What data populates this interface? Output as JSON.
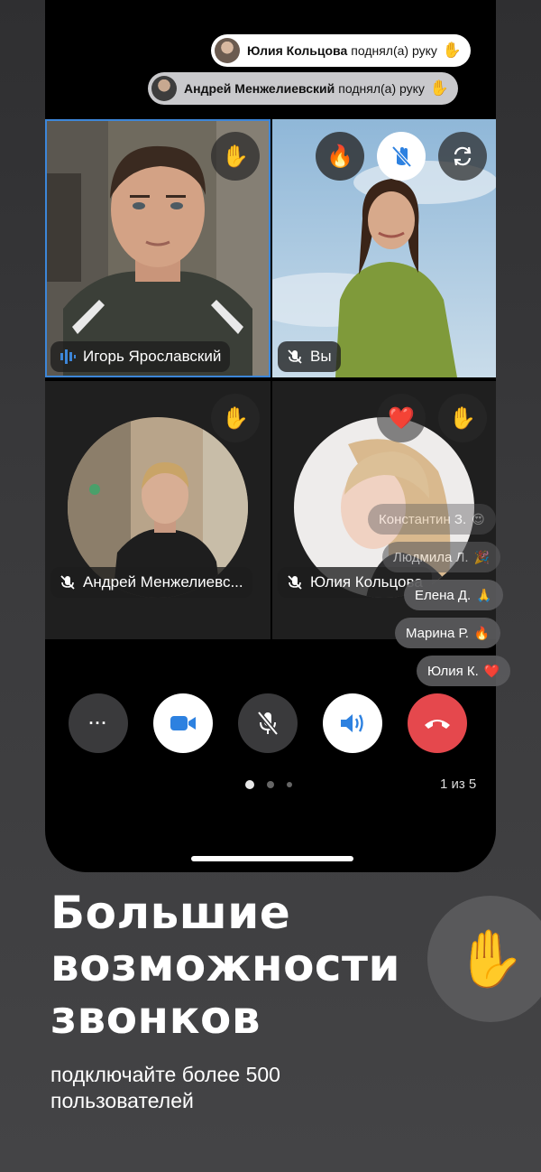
{
  "notifications": [
    {
      "name": "Юлия Кольцова",
      "action": "поднял(а) руку",
      "emoji": "✋"
    },
    {
      "name": "Андрей Менжелиевский",
      "action": "поднял(а) руку",
      "emoji": "✋"
    }
  ],
  "participants": {
    "igor": {
      "name": "Игорь Ярославский",
      "hand_emoji": "✋"
    },
    "me": {
      "name": "Вы",
      "reaction_emoji": "🔥"
    },
    "andrey": {
      "name": "Андрей Менжелиевс...",
      "hand_emoji": "✋"
    },
    "yulia": {
      "name": "Юлия Кольцова",
      "hand_emoji": "✋",
      "reaction_emoji": "❤️"
    }
  },
  "reactions": [
    {
      "name": "Константин З.",
      "emoji": "😍"
    },
    {
      "name": "Людмила Л.",
      "emoji": "🎉"
    },
    {
      "name": "Елена Д.",
      "emoji": "🙏"
    },
    {
      "name": "Марина Р.",
      "emoji": "🔥"
    },
    {
      "name": "Юлия К.",
      "emoji": "❤️"
    }
  ],
  "controls": {
    "more_label": "···",
    "end_call_color": "#e5484d",
    "accent_color": "#2d81e0"
  },
  "pagination": {
    "current": 1,
    "total": 3,
    "label": "1 из 5"
  },
  "promo": {
    "title_line1": "Большие",
    "title_line2": "возможности",
    "title_line3": "звонков",
    "subtitle": "подключайте более 500 пользователей",
    "hand_emoji": "✋"
  }
}
